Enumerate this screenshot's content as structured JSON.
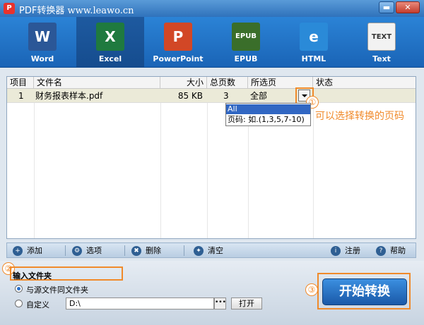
{
  "titlebar": {
    "title": "PDF转换器",
    "site": "www.leawo.cn",
    "minimize_symbol": "▬",
    "close_symbol": "✕"
  },
  "formats": [
    {
      "label": "Word",
      "icon": "W",
      "icon_name": "word-icon",
      "color": "#2b5797"
    },
    {
      "label": "Excel",
      "icon": "X",
      "icon_name": "excel-icon",
      "color": "#1f7a3f"
    },
    {
      "label": "PowerPoint",
      "icon": "P",
      "icon_name": "powerpoint-icon",
      "color": "#d24726"
    },
    {
      "label": "EPUB",
      "icon": "EPUB",
      "icon_name": "epub-icon",
      "color": "#3a6e2a"
    },
    {
      "label": "HTML",
      "icon": "e",
      "icon_name": "html-icon",
      "color": "#2a8ad8"
    },
    {
      "label": "Text",
      "icon": "TEXT",
      "icon_name": "text-icon",
      "color": "#f2f2f2"
    }
  ],
  "active_format": "Excel",
  "table": {
    "headers": [
      "项目",
      "文件名",
      "大小",
      "总页数",
      "所选页",
      "状态"
    ],
    "rows": [
      {
        "index": "1",
        "filename": "财务报表样本.pdf",
        "size": "85 KB",
        "pages": "3",
        "selected": "全部",
        "status": ""
      }
    ]
  },
  "page_dropdown": {
    "options": [
      "All",
      "页码: 如.(1,3,5,7-10)"
    ]
  },
  "annotations": {
    "circle1": "①",
    "hint1": "可以选择转换的页码",
    "circle2": "②",
    "circle3": "③"
  },
  "actionbar": {
    "add": "添加",
    "options": "选项",
    "delete": "删除",
    "clear": "清空",
    "register": "注册",
    "help": "帮助"
  },
  "output": {
    "title": "输入文件夹",
    "same_folder": "与源文件同文件夹",
    "custom": "自定义",
    "path": "D:\\",
    "browse": "•••",
    "open": "打开"
  },
  "start_button": "开始转换",
  "colors": {
    "accent": "#1a64b6",
    "annotation": "#f08a2a"
  }
}
